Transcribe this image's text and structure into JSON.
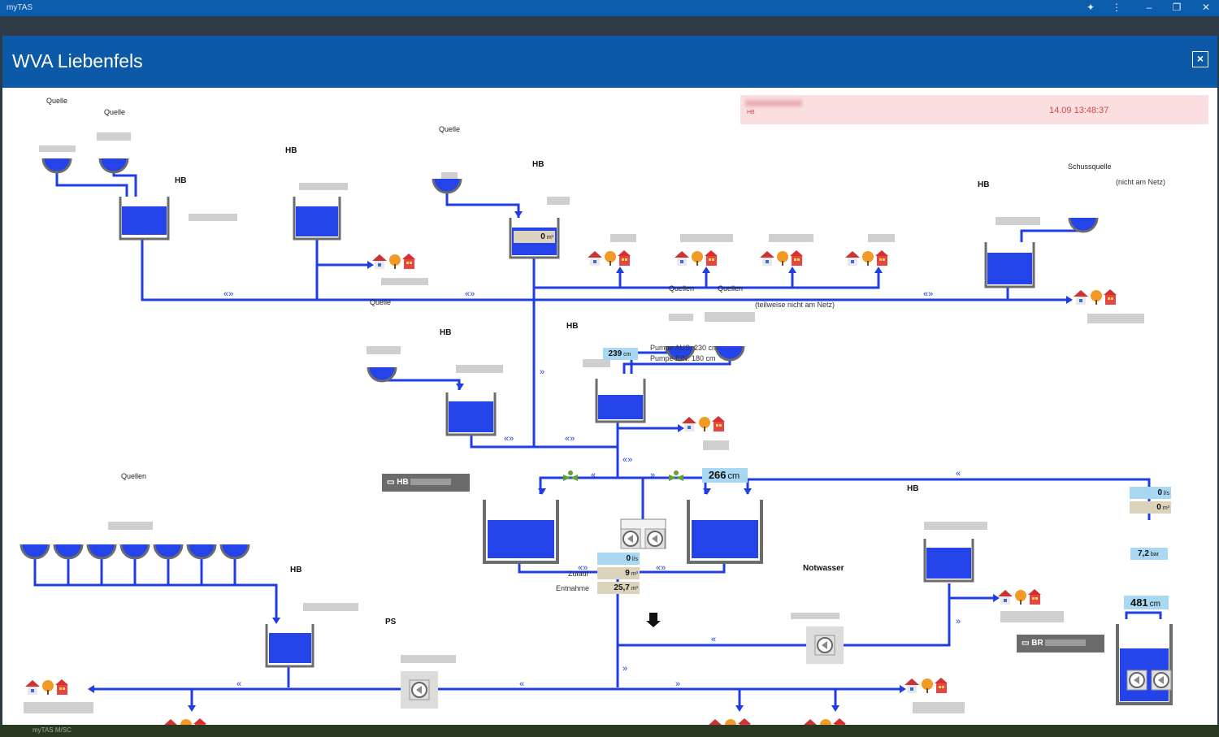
{
  "app": {
    "title": "myTAS",
    "taskbar_label": "myTAS M/SC"
  },
  "dialog": {
    "title": "WVA Liebenfels",
    "close_label": "×"
  },
  "alarm": {
    "time": "14.09 13:48:37",
    "prefix": "HB"
  },
  "labels": {
    "quelle": "Quelle",
    "quellen": "Quellen",
    "schussquelle": "Schussquelle",
    "nicht_am_netz": "(nicht am Netz)",
    "teilweise_nicht_am_netz": "(teilweise nicht am Netz)",
    "hb": "HB",
    "ps": "PS",
    "br": "BR",
    "notwasser": "Notwasser",
    "pumpe_aus": "Pumpe AUS: 230 cm",
    "pumpe_ein": "Pumpe EIN:  180 cm",
    "zulauf": "Zulauf",
    "entnahme": "Entnahme"
  },
  "values": {
    "hb_top_volume": "0",
    "hb_top_volume_unit": "m³",
    "hb_mid_level": "239",
    "hb_mid_level_unit": "cm",
    "main_right_level": "266",
    "main_right_level_unit": "cm",
    "flow": "0",
    "flow_unit": "l/s",
    "zulauf": "9",
    "zulauf_unit": "m³",
    "entnahme": "25,7",
    "entnahme_unit": "m³",
    "br_flow": "0",
    "br_flow_unit": "l/s",
    "br_volume": "0",
    "br_volume_unit": "m³",
    "br_pressure": "7,2",
    "br_pressure_unit": "bar",
    "br_level": "481",
    "br_level_unit": "cm"
  },
  "colors": {
    "pipe": "#1f3de0",
    "water": "#2443e8",
    "header": "#0b59a7",
    "alarm_bg": "#fbdfe0",
    "alarm_text": "#d2454d"
  }
}
